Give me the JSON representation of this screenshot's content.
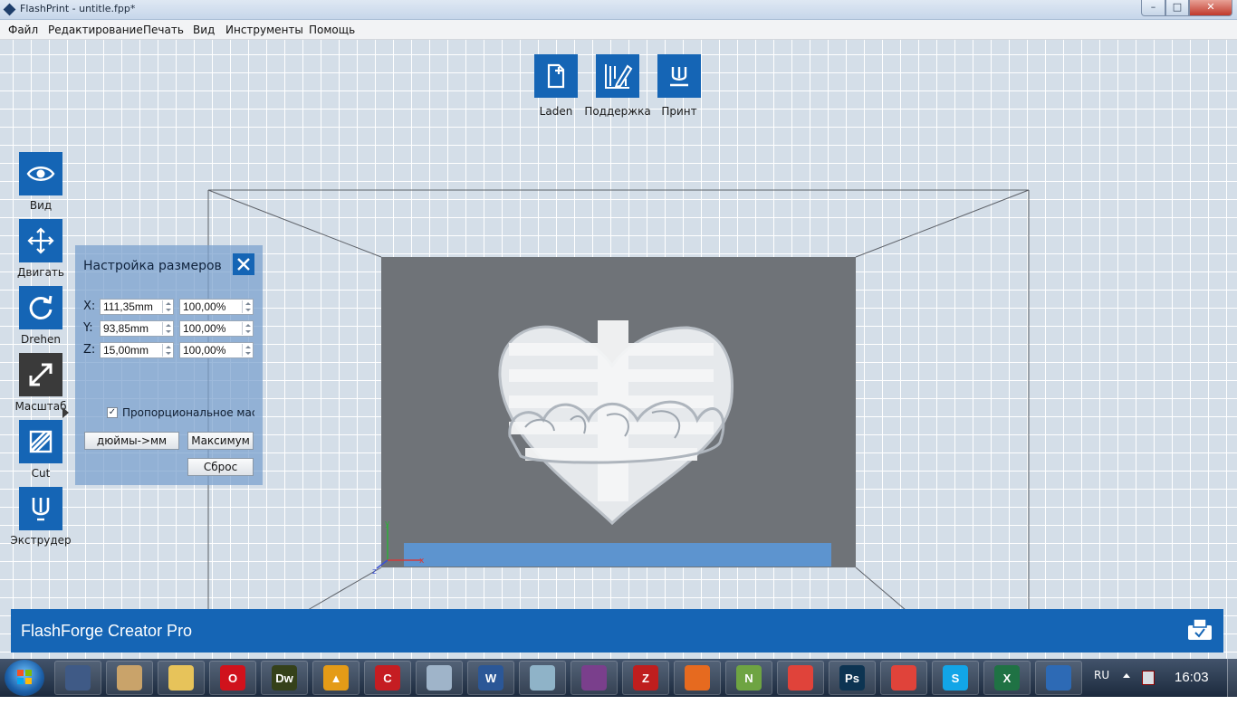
{
  "window": {
    "title": "FlashPrint - untitle.fpp*",
    "controls": {
      "minimize": "–",
      "maximize": "□",
      "close": "✕"
    }
  },
  "menu": {
    "items": [
      "Файл",
      "Редактирование",
      "Печать",
      "Вид",
      "Инструменты",
      "Помощь"
    ]
  },
  "top_toolbar": {
    "items": [
      {
        "label": "Laden",
        "icon": "new-file-icon"
      },
      {
        "label": "Поддержка",
        "icon": "support-edit-icon"
      },
      {
        "label": "Принт",
        "icon": "print-icon"
      }
    ]
  },
  "left_toolbar": {
    "items": [
      {
        "label": "Вид",
        "icon": "eye-icon"
      },
      {
        "label": "Двигать",
        "icon": "move-arrows-icon"
      },
      {
        "label": "Drehen",
        "icon": "rotate-icon"
      },
      {
        "label": "Масштаб",
        "icon": "scale-icon",
        "active": true
      },
      {
        "label": "Cut",
        "icon": "cut-icon"
      },
      {
        "label": "Экструдер",
        "icon": "extruder-icon"
      }
    ]
  },
  "scale_panel": {
    "title": "Настройка размеров",
    "rows": [
      {
        "axis": "X:",
        "size": "111,35mm",
        "percent": "100,00%"
      },
      {
        "axis": "Y:",
        "size": "93,85mm",
        "percent": "100,00%"
      },
      {
        "axis": "Z:",
        "size": "15,00mm",
        "percent": "100,00%"
      }
    ],
    "proportional_checked": true,
    "proportional_label": "Пропорциональное масштабирование",
    "checkmark": "✓",
    "buttons": {
      "inch_to_mm": "дюймы->мм",
      "maximum": "Максимум",
      "reset": "Сброс"
    }
  },
  "scene": {
    "axis_labels": {
      "x": "x",
      "y": "y",
      "z": "z"
    },
    "colors": {
      "build_frame": "#6f7378",
      "selection_band": "#5d94cf",
      "model": "#e9ecef"
    }
  },
  "bottom_bar": {
    "machine_name": "FlashForge Creator Pro"
  },
  "taskbar": {
    "language": "RU",
    "time": "16:03",
    "apps": [
      {
        "name": "keepass",
        "text": "",
        "color": "#3f5a86"
      },
      {
        "name": "paint",
        "text": "",
        "color": "#c9a36a"
      },
      {
        "name": "explorer",
        "text": "",
        "color": "#e7c35a"
      },
      {
        "name": "opera",
        "text": "O",
        "color": "#d0121c"
      },
      {
        "name": "dreamweaver",
        "text": "Dw",
        "color": "#35411a"
      },
      {
        "name": "archicad",
        "text": "▲",
        "color": "#e49b17"
      },
      {
        "name": "app-red",
        "text": "C",
        "color": "#c51d22"
      },
      {
        "name": "calculator",
        "text": "",
        "color": "#9fb4c9"
      },
      {
        "name": "word",
        "text": "W",
        "color": "#2b5797"
      },
      {
        "name": "flashprint-gray",
        "text": "",
        "color": "#8fb3c8"
      },
      {
        "name": "winrar",
        "text": "",
        "color": "#7a3f8c"
      },
      {
        "name": "filezilla",
        "text": "Z",
        "color": "#bf1e1e"
      },
      {
        "name": "firefox",
        "text": "",
        "color": "#e66a1f"
      },
      {
        "name": "notepad-plus",
        "text": "N",
        "color": "#6ea442"
      },
      {
        "name": "chrome",
        "text": "",
        "color": "#e0433a"
      },
      {
        "name": "photoshop",
        "text": "Ps",
        "color": "#0d3452"
      },
      {
        "name": "chrome-2",
        "text": "",
        "color": "#e0433a"
      },
      {
        "name": "skype",
        "text": "S",
        "color": "#12a5e7"
      },
      {
        "name": "excel",
        "text": "X",
        "color": "#1f7244"
      },
      {
        "name": "flashprint",
        "text": "",
        "color": "#2d6ab5"
      }
    ]
  }
}
